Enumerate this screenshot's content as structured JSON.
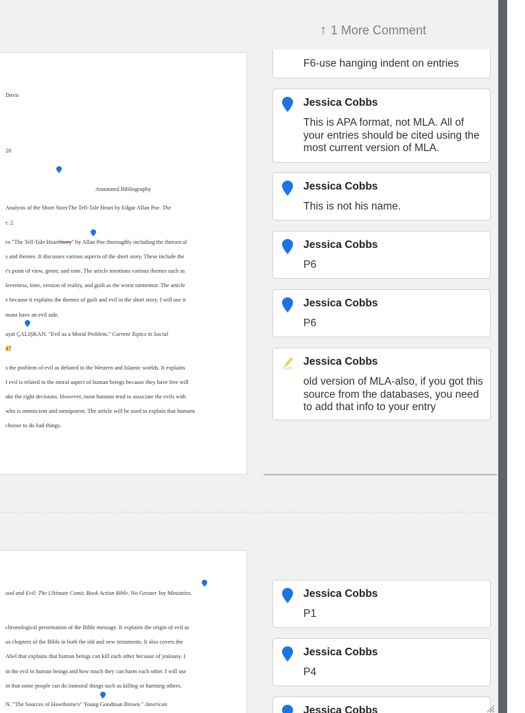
{
  "header": {
    "more_comment": "1 More Comment"
  },
  "colors": {
    "pin_blue": "#1a73e8",
    "highlight_yellow": "#f4e67a",
    "pencil_yellow": "#f2d45c"
  },
  "page1": {
    "lines": [
      "Davis",
      "20",
      "Annotated Bibliography",
      " Analysis of the Short StoryThe Tell-Tale Heart by Edgar Allan Poe.",
      " The",
      "r. 2.",
      "es \"The Tell-Tale Heart",
      "Story",
      "\" by Allan Poe thoroughly including the rhetorical",
      "s and themes. It discusses various aspects of the short story. These include the",
      "r's point of view, genre, and tone. The article mentions various themes such as",
      "leverness, time, version of reality, and guilt as the worst tormentor. The article",
      "e because it explains the themes of guilt and evil in the short story. I will use it",
      "mans have an evil side.",
      "ayat ÇALIŞKAN. \"Evil as a Moral Problem.\"",
      " Current Topics in Social",
      "47",
      "s the problem of evil as debated in the Western and Islamic worlds. It explains",
      "f evil is related to the moral aspect of human beings because they have free will",
      "ake the right decisions. However, most humans tend to associate the evils with",
      "who is omniscient and omnipotent. The article will be used to explain that humans",
      "choose to do bad things."
    ]
  },
  "page2": {
    "lines": [
      "ood and Evil: The Ultimate Comic Book Action Bible.",
      " No Greater Joy Ministries.",
      "chronological presentation of the Bible message. It explains the origin of evil as",
      "us chapters of the Bible in both the old and new testaments. It also covers the",
      "Abel that explains that human beings can kill each other because of jealousy. I",
      "in the evil in human beings and how much they can harm each other. I will use",
      "in that some people can do immoral things such as killing or harming others.",
      "N. \"The Sources of Hawthorne's\" Young Goodman Brown.\"",
      " American"
    ]
  },
  "comments": [
    {
      "author": "",
      "body": "F6-use hanging indent on entries",
      "icon": "none"
    },
    {
      "author": "Jessica Cobbs",
      "body": "This is APA format, not MLA.  All of your entries should be cited using the most current version of MLA.",
      "icon": "pin-icon"
    },
    {
      "author": "Jessica Cobbs",
      "body": "This is not his name.",
      "icon": "pin-icon"
    },
    {
      "author": "Jessica Cobbs",
      "body": "P6",
      "icon": "pin-icon"
    },
    {
      "author": "Jessica Cobbs",
      "body": "P6",
      "icon": "pin-icon"
    },
    {
      "author": "Jessica Cobbs",
      "body": "old version of MLA-also, if you got this source from the databases, you need to add that info to your entry",
      "icon": "pencil-icon"
    },
    {
      "author": "Jessica Cobbs",
      "body": "P1",
      "icon": "pin-icon"
    },
    {
      "author": "Jessica Cobbs",
      "body": "P4",
      "icon": "pin-icon"
    },
    {
      "author": "Jessica Cobbs",
      "body": "",
      "icon": "pin-icon"
    }
  ]
}
